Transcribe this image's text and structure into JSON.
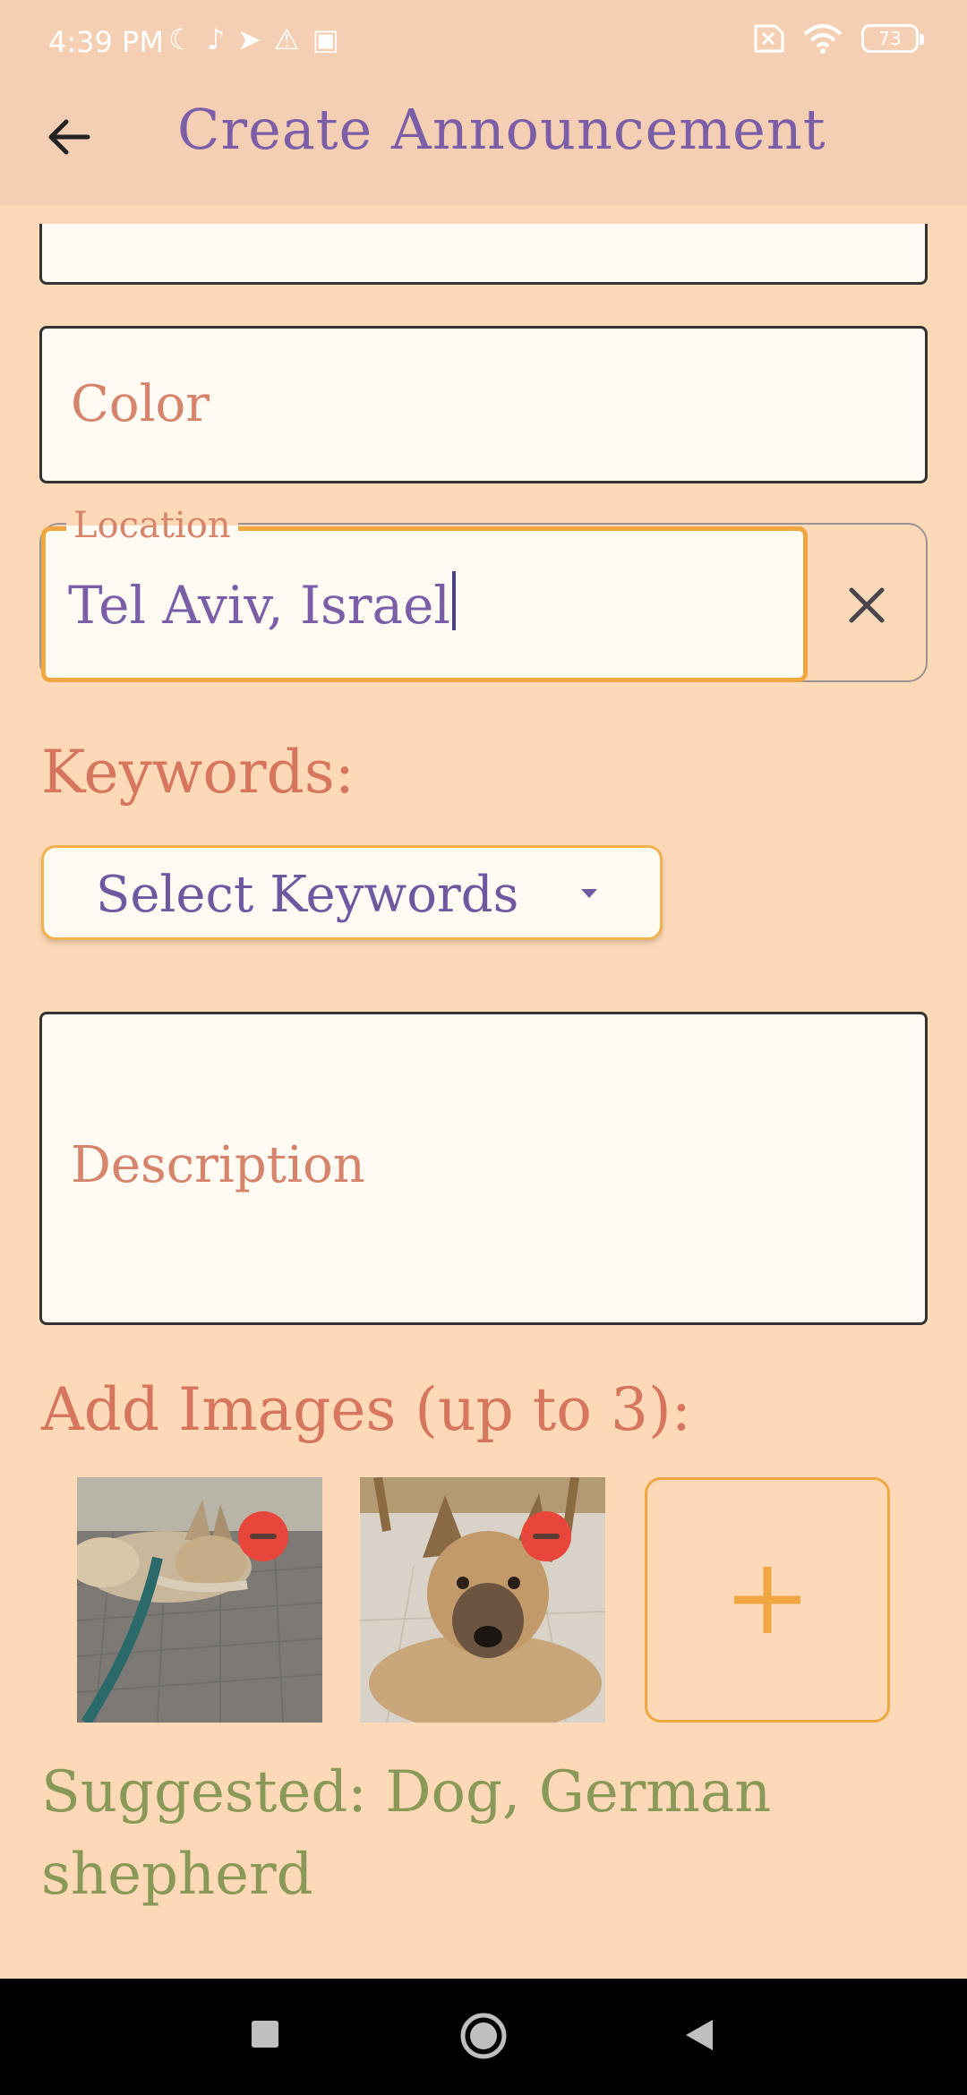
{
  "status_bar": {
    "time": "4:39 PM",
    "battery": "73"
  },
  "app_bar": {
    "title": "Create Announcement",
    "back_icon": "arrow-left-icon"
  },
  "form": {
    "color_placeholder": "Color",
    "location": {
      "label": "Location",
      "value": "Tel Aviv, Israel"
    },
    "keywords_heading": "Keywords:",
    "keywords_button": "Select Keywords",
    "description_placeholder": "Description",
    "images_heading": "Add Images (up to 3):",
    "suggested": "Suggested: Dog, German shepherd"
  },
  "colors": {
    "background": "#fdd9b8",
    "appbar": "#f5cfb3",
    "title_purple": "#7b5ea7",
    "heading_salmon": "#d7765f",
    "accent_orange": "#f0a742",
    "suggestion_green": "#8a9957",
    "remove_red": "#e8463a"
  }
}
